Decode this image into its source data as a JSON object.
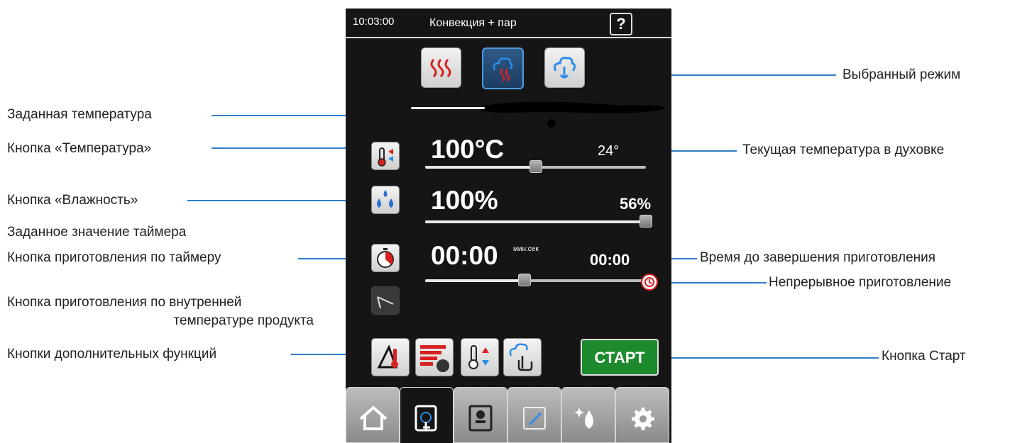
{
  "header": {
    "time": "10:03:00",
    "mode": "Конвекция + пар",
    "help": "?"
  },
  "modes": [
    {
      "name": "convection",
      "icon": "convection-icon"
    },
    {
      "name": "combi",
      "icon": "combi-steam-icon",
      "selected": true
    },
    {
      "name": "steam",
      "icon": "steam-icon"
    }
  ],
  "temperature": {
    "set": "100°C",
    "current": "24°",
    "level": 0.5
  },
  "humidity": {
    "set": "100%",
    "current": "56%",
    "level": 1.0
  },
  "timer": {
    "set": "00:00",
    "unit": "мин:сек",
    "remaining": "00:00",
    "level": 0.45
  },
  "start_label": "СТАРТ",
  "tabs": [
    "home-icon",
    "manual-icon",
    "cookbook-icon",
    "edit-icon",
    "cleaning-icon",
    "settings-icon"
  ],
  "annotations": {
    "set_temperature": "Заданная температура",
    "temp_button": "Кнопка «Температура»",
    "humidity_button": "Кнопка «Влажность»",
    "timer_value": "Заданное значение таймера",
    "timer_button": "Кнопка приготовления по таймеру",
    "probe_line1": "Кнопка приготовления по внутренней",
    "probe_line2": "температуре продукта",
    "extra_functions": "Кнопки дополнительных функций",
    "selected_mode": "Выбранный режим",
    "current_temp": "Текущая температура в духовке",
    "remaining_time": "Время до завершения приготовления",
    "continuous": "Непрерывное приготовление",
    "start_button": "Кнопка Старт"
  }
}
